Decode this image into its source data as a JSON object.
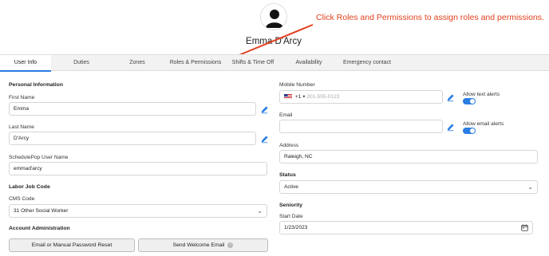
{
  "annotation": "Click Roles and Permissions to assign roles and permissions.",
  "user": {
    "name": "Emma D'Arcy"
  },
  "tabs": [
    {
      "label": "User Info"
    },
    {
      "label": "Duties"
    },
    {
      "label": "Zones"
    },
    {
      "label": "Roles & Permissions"
    },
    {
      "label": "Shifts & Time Off"
    },
    {
      "label": "Availability"
    },
    {
      "label": "Emergency contact"
    }
  ],
  "personal": {
    "section": "Personal Information",
    "first_name_label": "First Name",
    "first_name": "Emma",
    "last_name_label": "Last Name",
    "last_name": "D'Arcy",
    "username_label": "SchedulePop User Name",
    "username": "emmad'arcy"
  },
  "labor": {
    "section": "Labor Job Code",
    "cms_label": "CMS Code",
    "cms_value": "31 Other Social Worker"
  },
  "account": {
    "section": "Account Administration",
    "reset_button": "Email or Manual Password Reset",
    "welcome_button": "Send Welcome Email",
    "info_glyph": "i"
  },
  "contact": {
    "mobile_label": "Mobile Number",
    "mobile_code": "+1",
    "mobile_placeholder": "201-555-0123",
    "text_alerts_label": "Allow text alerts",
    "email_label": "Email",
    "email_value": "",
    "email_alerts_label": "Allow email alerts",
    "address_label": "Address",
    "address_value": "Raleigh, NC"
  },
  "status": {
    "section": "Status",
    "value": "Active"
  },
  "seniority": {
    "section": "Seniority",
    "start_label": "Start Date",
    "start_value": "1/23/2023"
  },
  "colors": {
    "accent": "#2a7de1",
    "annotation": "#e2411f"
  },
  "icons": [
    "avatar-icon",
    "pencil-icon",
    "chevron-down-icon",
    "calendar-icon",
    "info-icon",
    "us-flag-icon"
  ]
}
